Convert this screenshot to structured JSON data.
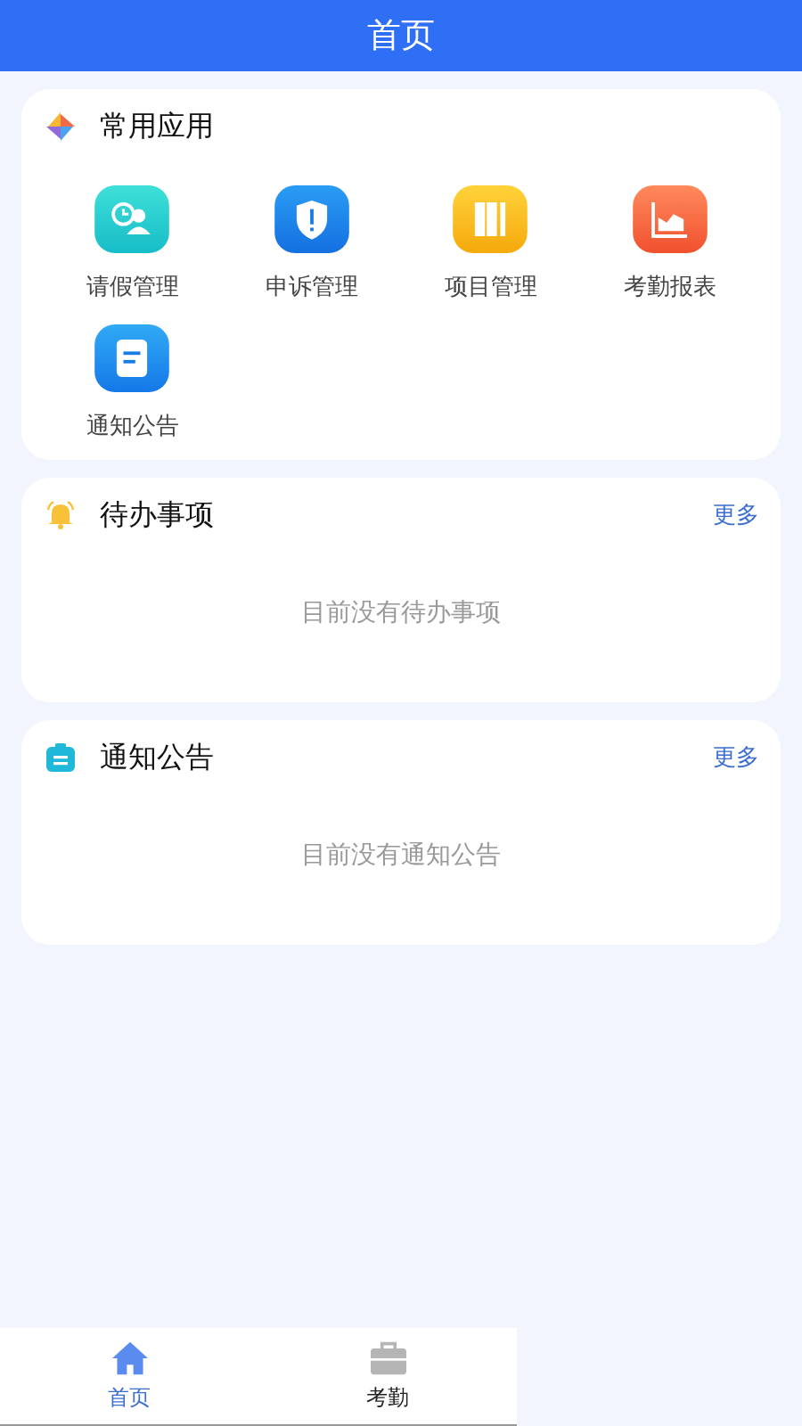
{
  "header": {
    "title": "首页"
  },
  "apps_card": {
    "title": "常用应用",
    "apps": [
      {
        "label": "请假管理",
        "kind": "leave"
      },
      {
        "label": "申诉管理",
        "kind": "appeal"
      },
      {
        "label": "项目管理",
        "kind": "project"
      },
      {
        "label": "考勤报表",
        "kind": "report"
      },
      {
        "label": "通知公告",
        "kind": "notice"
      }
    ]
  },
  "sections": [
    {
      "kind": "todo",
      "title": "待办事项",
      "more": "更多",
      "empty": "目前没有待办事项"
    },
    {
      "kind": "notice",
      "title": "通知公告",
      "more": "更多",
      "empty": "目前没有通知公告"
    }
  ],
  "tab_bar": [
    {
      "label": "首页",
      "kind": "home",
      "selected": true
    },
    {
      "label": "考勤",
      "kind": "attendance",
      "selected": false
    }
  ]
}
